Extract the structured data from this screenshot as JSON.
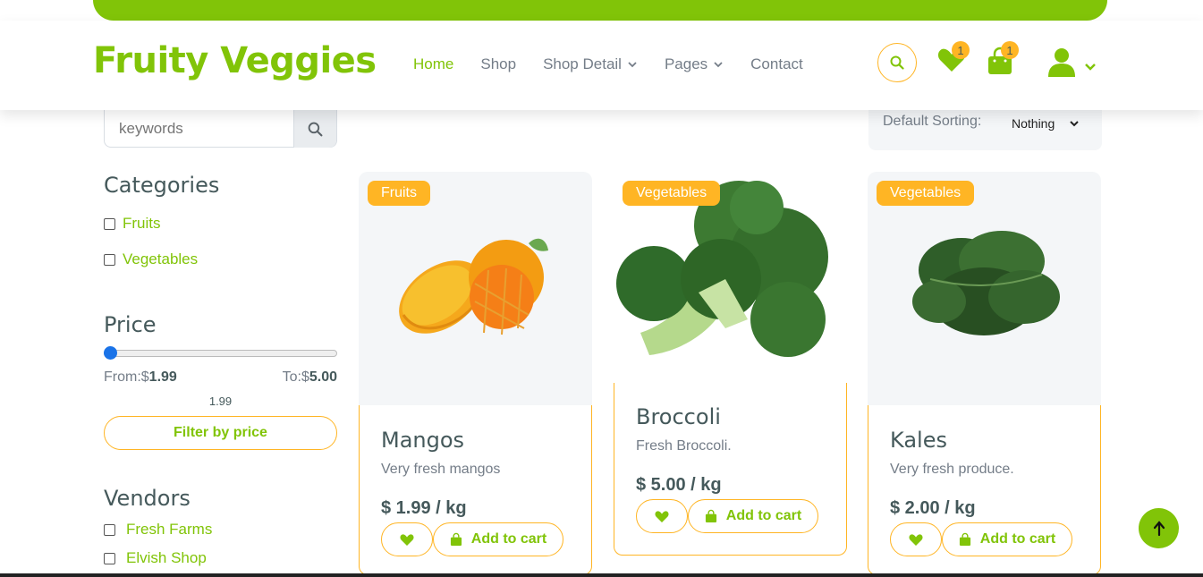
{
  "brand": "Fruity Veggies",
  "nav": {
    "links": [
      "Home",
      "Shop",
      "Shop Detail",
      "Pages",
      "Contact"
    ],
    "wishlist_count": "1",
    "cart_count": "1"
  },
  "sidebar": {
    "search_placeholder": "keywords",
    "categories_title": "Categories",
    "categories": [
      "Fruits",
      "Vegetables"
    ],
    "price_title": "Price",
    "price_from_label": "From:$",
    "price_from": "1.99",
    "price_to_label": "To:$",
    "price_to": "5.00",
    "range_value": "1.99",
    "range_fraction": 0,
    "filter_label": "Filter by price",
    "vendors_title": "Vendors",
    "vendors": [
      "Fresh Farms",
      "Elvish Shop"
    ]
  },
  "sorting": {
    "label": "Default Sorting:",
    "selected": "Nothing"
  },
  "products": [
    {
      "tag": "Fruits",
      "name": "Mangos",
      "desc": "Very fresh mangos",
      "price": "$ 1.99 / kg",
      "cart_label": "Add to cart"
    },
    {
      "tag": "Vegetables",
      "name": "Broccoli",
      "desc": "Fresh Broccoli.",
      "price": "$ 5.00 / kg",
      "cart_label": "Add to cart"
    },
    {
      "tag": "Vegetables",
      "name": "Kales",
      "desc": "Very fresh produce.",
      "price": "$ 2.00 / kg",
      "cart_label": "Add to cart"
    }
  ],
  "colors": {
    "primary": "#81c408",
    "secondary": "#ffb524",
    "text": "#45595b",
    "muted": "#747d88"
  }
}
